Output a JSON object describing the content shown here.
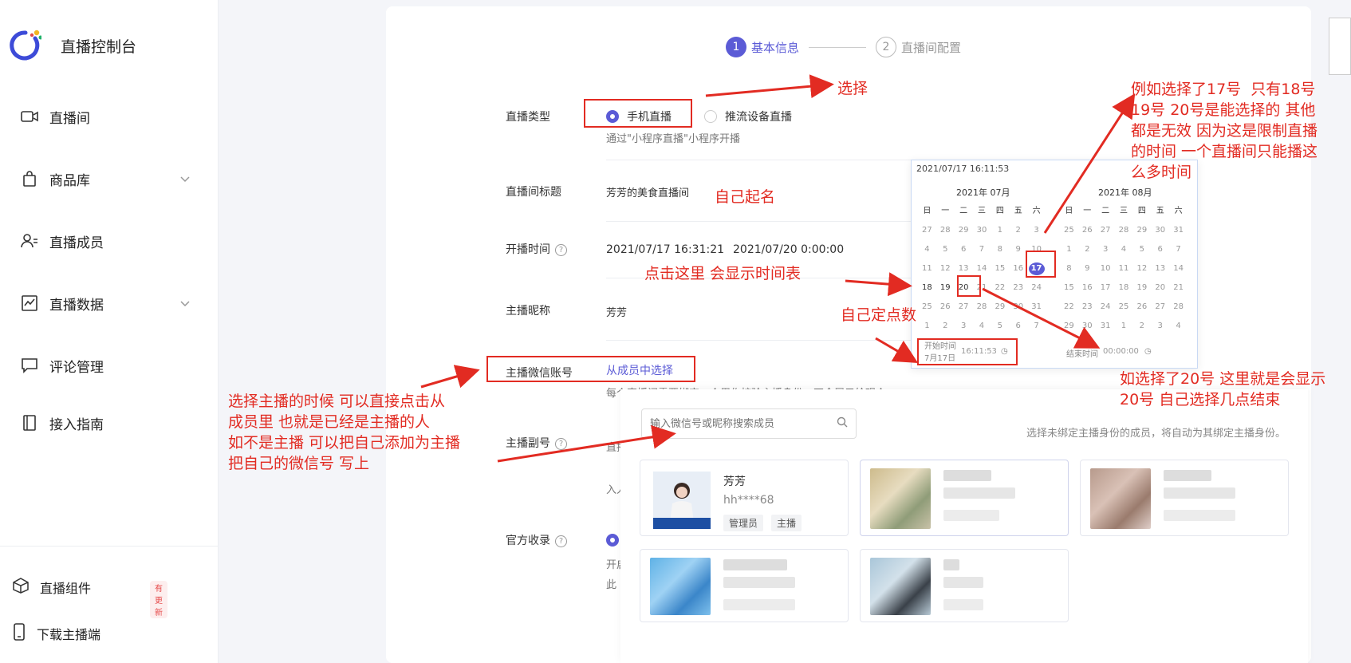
{
  "sidebar": {
    "brand_title": "直播控制台",
    "items": [
      {
        "label": "直播间",
        "icon": "video-icon"
      },
      {
        "label": "商品库",
        "icon": "shopping-bag-icon"
      },
      {
        "label": "直播成员",
        "icon": "members-icon"
      },
      {
        "label": "直播数据",
        "icon": "chart-icon"
      },
      {
        "label": "评论管理",
        "icon": "comment-icon"
      },
      {
        "label": "接入指南",
        "icon": "book-icon"
      }
    ],
    "footer": [
      {
        "label": "直播组件",
        "icon": "cube-icon",
        "badge": "有更新"
      },
      {
        "label": "下载主播端",
        "icon": "phone-icon"
      }
    ]
  },
  "steps": [
    {
      "num": "1",
      "label": "基本信息"
    },
    {
      "num": "2",
      "label": "直播间配置"
    }
  ],
  "form": {
    "live_type": {
      "label": "直播类型",
      "option_phone": "手机直播",
      "option_push": "推流设备直播",
      "help": "通过\"小程序直播\"小程序开播"
    },
    "room_title": {
      "label": "直播间标题",
      "value": "芳芳的美食直播间"
    },
    "start_time": {
      "label": "开播时间",
      "start": "2021/07/17 16:31:21",
      "end": "2021/07/20 0:00:00"
    },
    "anchor_nick": {
      "label": "主播昵称",
      "value": "芳芳"
    },
    "anchor_wechat": {
      "label": "主播微信账号",
      "link": "从成员中选择",
      "help": "每个直播间需要绑定一个用作核验主播身份，不会展示给观众"
    },
    "sub_account": {
      "label": "主播副号",
      "help_a": "直播",
      "help_b": "入人"
    },
    "official": {
      "label": "官方收录",
      "help_a": "开启",
      "help_b": "此"
    }
  },
  "calendar": {
    "header": "2021/07/17 16:11:53",
    "left_month": "2021年   07月",
    "right_month": "2021年   08月",
    "weekdays": [
      "日",
      "一",
      "二",
      "三",
      "四",
      "五",
      "六"
    ],
    "left_days": [
      "27",
      "28",
      "29",
      "30",
      "1",
      "2",
      "3",
      "4",
      "5",
      "6",
      "7",
      "8",
      "9",
      "10",
      "11",
      "12",
      "13",
      "14",
      "15",
      "16",
      "17",
      "18",
      "19",
      "20",
      "21",
      "22",
      "23",
      "24",
      "25",
      "26",
      "27",
      "28",
      "29",
      "30",
      "31",
      "1",
      "2",
      "3",
      "4",
      "5",
      "6",
      "7"
    ],
    "right_days": [
      "25",
      "26",
      "27",
      "28",
      "29",
      "30",
      "31",
      "1",
      "2",
      "3",
      "4",
      "5",
      "6",
      "7",
      "8",
      "9",
      "10",
      "11",
      "12",
      "13",
      "14",
      "15",
      "16",
      "17",
      "18",
      "19",
      "20",
      "21",
      "22",
      "23",
      "24",
      "25",
      "26",
      "27",
      "28",
      "29",
      "30",
      "31",
      "1",
      "2",
      "3",
      "4"
    ],
    "start_label": "开始时间",
    "start_date": "7月17日",
    "start_time": "16:11:53",
    "end_label": "结束时间",
    "end_time": "00:00:00"
  },
  "member_panel": {
    "search_placeholder": "输入微信号或昵称搜索成员",
    "hint": "选择未绑定主播身份的成员，将自动为其绑定主播身份。",
    "members": [
      {
        "name": "芳芳",
        "id": "hh****68",
        "tags": [
          "管理员",
          "主播"
        ]
      }
    ]
  },
  "annotations": {
    "select": "选择",
    "calendar_note": "例如选择了17号  只有18号\n19号 20号是能选择的 其他\n都是无效 因为这是限制直播\n的时间 一个直播间只能播这\n么多时间",
    "name_self": "自己起名",
    "click_here": "点击这里 会显示时间表",
    "pick_point": "自己定点数",
    "end_note": "如选择了20号 这里就是会显示\n20号 自己选择几点结束",
    "anchor_note": "选择主播的时候 可以直接点击从\n成员里 也就是已经是主播的人\n如不是主播 可以把自己添加为主播\n把自己的微信号 写上"
  },
  "colors": {
    "accent": "#5b5bd6",
    "annotation": "#e22b22"
  }
}
